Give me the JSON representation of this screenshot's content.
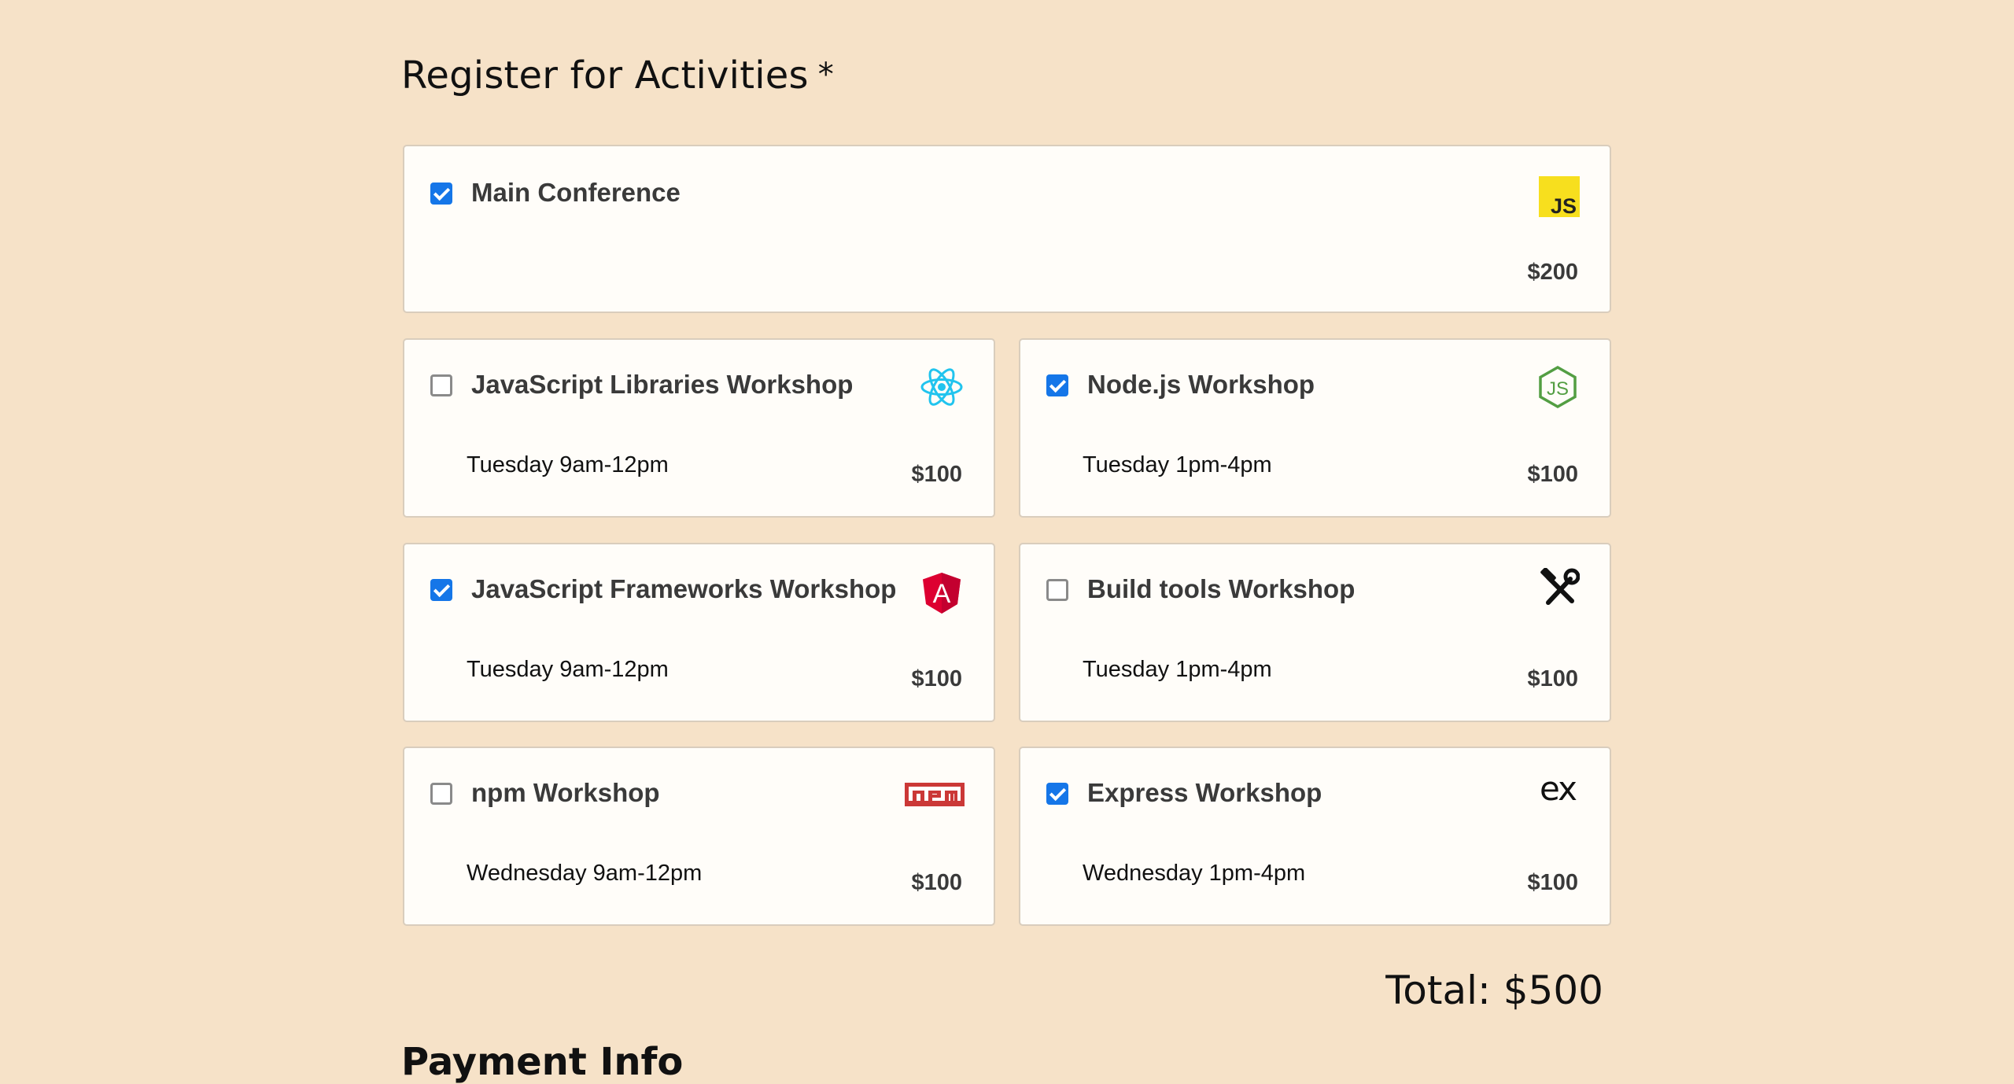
{
  "activities": {
    "title": "Register for Activities",
    "required_mark": "*",
    "main": {
      "name": "Main Conference",
      "price": "$200",
      "checked": true,
      "icon": "javascript-logo-icon"
    },
    "workshops": [
      {
        "name": "JavaScript Libraries Workshop",
        "time": "Tuesday 9am-12pm",
        "price": "$100",
        "checked": false,
        "icon": "react-logo-icon"
      },
      {
        "name": "Node.js Workshop",
        "time": "Tuesday 1pm-4pm",
        "price": "$100",
        "checked": true,
        "icon": "nodejs-logo-icon"
      },
      {
        "name": "JavaScript Frameworks Workshop",
        "time": "Tuesday 9am-12pm",
        "price": "$100",
        "checked": true,
        "icon": "angular-logo-icon"
      },
      {
        "name": "Build tools Workshop",
        "time": "Tuesday 1pm-4pm",
        "price": "$100",
        "checked": false,
        "icon": "tools-icon"
      },
      {
        "name": "npm Workshop",
        "time": "Wednesday 9am-12pm",
        "price": "$100",
        "checked": false,
        "icon": "npm-logo-icon"
      },
      {
        "name": "Express Workshop",
        "time": "Wednesday 1pm-4pm",
        "price": "$100",
        "checked": true,
        "icon": "express-logo-icon"
      }
    ],
    "total": "Total: $500"
  },
  "payment": {
    "title": "Payment Info"
  },
  "colors": {
    "background": "#f6e2c8",
    "checkbox_checked": "#1576e8",
    "js_yellow": "#f7df1e",
    "react_cyan": "#21c4ee",
    "node_green": "#539e43",
    "angular_red": "#dd0031",
    "npm_red": "#cb3837"
  }
}
